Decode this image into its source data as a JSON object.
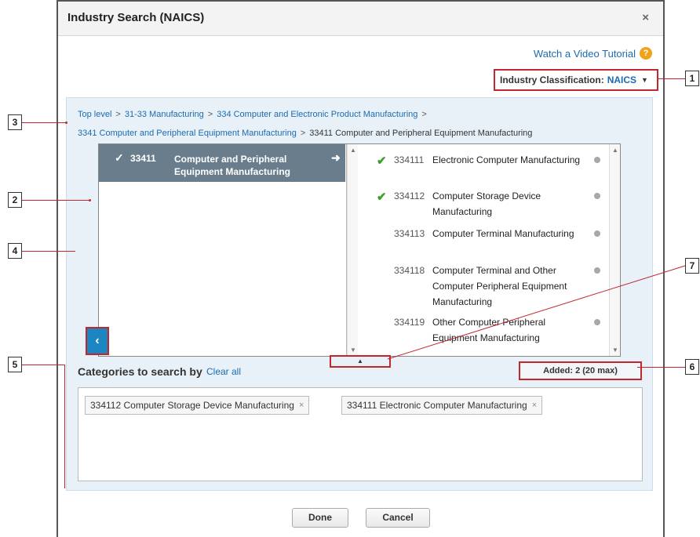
{
  "dialog": {
    "title": "Industry Search (NAICS)",
    "close_glyph": "×",
    "video_link": "Watch a Video Tutorial",
    "help_glyph": "?",
    "classification_label": "Industry Classification:",
    "classification_value": "NAICS",
    "classification_caret": "▼"
  },
  "breadcrumb": {
    "crumbs": [
      "Top level",
      "31-33 Manufacturing",
      "334 Computer and Electronic Product Manufacturing",
      "3341 Computer and Peripheral Equipment Manufacturing"
    ],
    "separator": ">",
    "current": "33411 Computer and Peripheral Equipment Manufacturing"
  },
  "left_column": {
    "selected": {
      "check": "✓",
      "code": "33411",
      "name": "Computer and Peripheral Equipment Manufacturing",
      "arrow": "➜"
    }
  },
  "right_column": {
    "items": [
      {
        "code": "334111",
        "name": "Electronic Computer Manufacturing",
        "checked": true
      },
      {
        "code": "334112",
        "name": "Computer Storage Device Manufacturing",
        "checked": true
      },
      {
        "code": "334113",
        "name": "Computer Terminal Manufacturing",
        "checked": false
      },
      {
        "code": "334118",
        "name": "Computer Terminal and Other Computer Peripheral Equipment Manufacturing",
        "checked": false
      },
      {
        "code": "334119",
        "name": "Other Computer Peripheral Equipment Manufacturing",
        "checked": false
      }
    ],
    "check_glyph": "✔"
  },
  "back_button_glyph": "‹",
  "categories": {
    "label": "Categories to search by",
    "clear_all": "Clear all",
    "added": "Added: 2 (20 max)",
    "handle_glyph": "▲",
    "chips": [
      {
        "text": "334112 Computer Storage Device Manufacturing",
        "remove": "×"
      },
      {
        "text": "334111 Electronic Computer Manufacturing",
        "remove": "×"
      }
    ]
  },
  "footer": {
    "done": "Done",
    "cancel": "Cancel"
  },
  "callouts": [
    "1",
    "2",
    "3",
    "4",
    "5",
    "6",
    "7"
  ],
  "colors": {
    "callout_red": "#c0282d",
    "link_blue": "#1a6bb0",
    "selected_row": "#6a7d8c",
    "back_button": "#1b86c2",
    "check_green": "#3aa02a"
  }
}
